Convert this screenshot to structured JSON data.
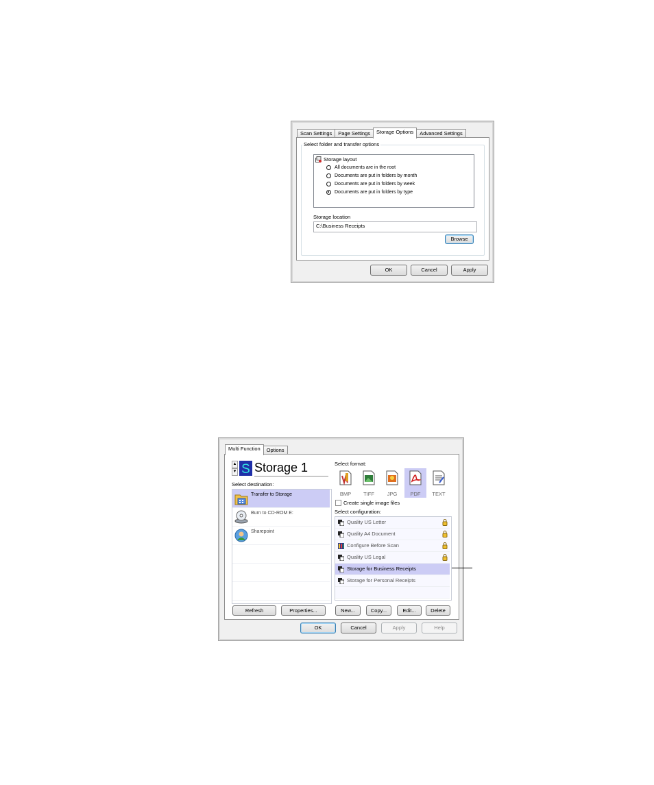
{
  "dialog1": {
    "tabs": [
      "Scan Settings",
      "Page Settings",
      "Storage Options",
      "Advanced Settings"
    ],
    "active_tab": "Storage Options",
    "group_label": "Select folder and transfer options",
    "storage_layout_label": "Storage layout",
    "radio_options": [
      "All documents are in the root",
      "Documents are put in folders by month",
      "Documents are put in folders by week",
      "Documents are put in folders by type"
    ],
    "selected_radio": "Documents are put in folders by type",
    "storage_location_label": "Storage location",
    "storage_location_value": "C:\\Business Receipts",
    "browse_label": "Browse",
    "ok_label": "OK",
    "cancel_label": "Cancel",
    "apply_label": "Apply"
  },
  "dialog2": {
    "tabs": [
      "Multi Function",
      "Options"
    ],
    "active_tab": "Multi Function",
    "destination_title": "Storage 1",
    "select_destination_label": "Select destination:",
    "destinations": [
      {
        "label": "Transfer to Storage",
        "selected": true,
        "icon": "storage-folder-icon"
      },
      {
        "label": "Burn to CD-ROM  E:",
        "selected": false,
        "icon": "cd-rom-icon"
      },
      {
        "label": "Sharepoint",
        "selected": false,
        "icon": "sharepoint-icon"
      }
    ],
    "select_format_label": "Select format:",
    "formats": [
      "BMP",
      "TIFF",
      "JPG",
      "PDF",
      "TEXT"
    ],
    "selected_format": "PDF",
    "single_image_label": "Create single image files",
    "single_image_checked": false,
    "select_configuration_label": "Select configuration:",
    "configurations": [
      {
        "label": "Quality US Letter",
        "locked": true,
        "selected": false
      },
      {
        "label": "Quality A4 Document",
        "locked": true,
        "selected": false
      },
      {
        "label": "Configure Before Scan",
        "locked": true,
        "selected": false
      },
      {
        "label": "Quality US Legal",
        "locked": true,
        "selected": false
      },
      {
        "label": "Storage for Business Receipts",
        "locked": false,
        "selected": true
      },
      {
        "label": "Storage for Personal Receipts",
        "locked": false,
        "selected": false
      }
    ],
    "refresh_label": "Refresh",
    "properties_label": "Properties...",
    "new_label": "New...",
    "copy_label": "Copy...",
    "edit_label": "Edit...",
    "delete_label": "Delete",
    "ok_label": "OK",
    "cancel_label": "Cancel",
    "apply_label": "Apply",
    "help_label": "Help"
  },
  "colors": {
    "selection": "#ccccf5",
    "dialog_bg": "#f0f0f0",
    "accent_blue": "#3c7fb1"
  }
}
